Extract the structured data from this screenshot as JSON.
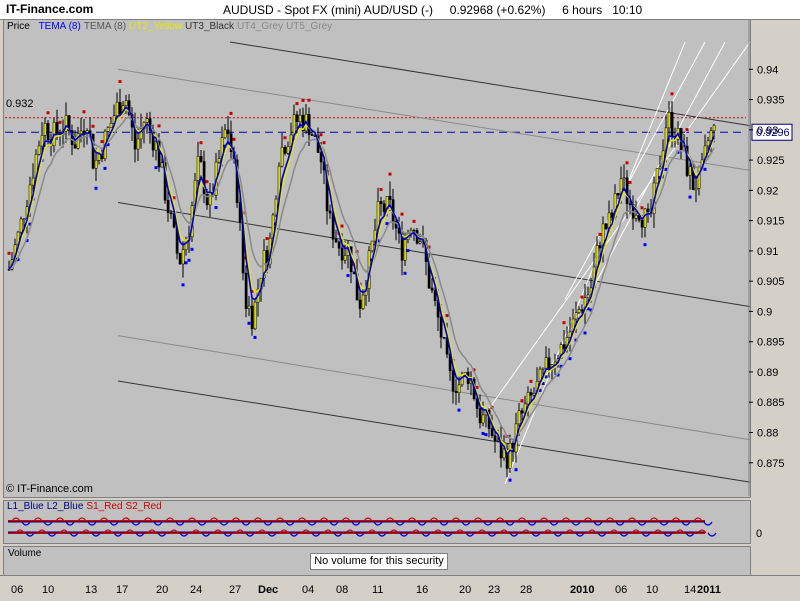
{
  "header": {
    "site": "IT-Finance.com",
    "instrument": "AUDUSD - Spot FX (mini) AUD/USD (-)",
    "last": "0.92968",
    "change": "(+0.62%)",
    "timeframe": "6 hours",
    "time": "10:10"
  },
  "price_panel": {
    "label": "Price",
    "legend": [
      {
        "text": "TEMA (8)",
        "color": "#0000ff"
      },
      {
        "text": "TEMA (8)",
        "color": "#555555"
      },
      {
        "text": "UT2_Yellow",
        "color": "#e8e800"
      },
      {
        "text": "UT3_Black",
        "color": "#333333"
      },
      {
        "text": "UT4_Grey",
        "color": "#888888"
      },
      {
        "text": "UT5_Grey",
        "color": "#888888"
      }
    ],
    "hline_red_label": "0.932",
    "last_price_box": "0.9296",
    "watermark": "© IT-Finance.com"
  },
  "indicator_panel": {
    "legend": [
      {
        "text": "L1_Blue",
        "color": "#000080"
      },
      {
        "text": "L2_Blue",
        "color": "#000080"
      },
      {
        "text": "S1_Red",
        "color": "#cc0000"
      },
      {
        "text": "S2_Red",
        "color": "#cc0000"
      }
    ],
    "zero_label": "0"
  },
  "volume_panel": {
    "label": "Volume",
    "message": "No volume for this security"
  },
  "x_axis": {
    "ticks": [
      {
        "label": "06",
        "bold": false
      },
      {
        "label": "10",
        "bold": false
      },
      {
        "label": "13",
        "bold": false
      },
      {
        "label": "17",
        "bold": false
      },
      {
        "label": "20",
        "bold": false
      },
      {
        "label": "24",
        "bold": false
      },
      {
        "label": "27",
        "bold": false
      },
      {
        "label": "Dec",
        "bold": true
      },
      {
        "label": "04",
        "bold": false
      },
      {
        "label": "08",
        "bold": false
      },
      {
        "label": "11",
        "bold": false
      },
      {
        "label": "16",
        "bold": false
      },
      {
        "label": "20",
        "bold": false
      },
      {
        "label": "23",
        "bold": false
      },
      {
        "label": "28",
        "bold": false
      },
      {
        "label": "2010",
        "bold": true
      },
      {
        "label": "06",
        "bold": false
      },
      {
        "label": "10",
        "bold": false
      },
      {
        "label": "14",
        "bold": false
      },
      {
        "label": "2011",
        "bold": true
      }
    ]
  },
  "chart_data": {
    "type": "candlestick",
    "title": "AUDUSD - Spot FX (mini) AUD/USD (-)",
    "xlabel": "",
    "ylabel": "",
    "ylim": [
      0.8705,
      0.9455
    ],
    "y_ticks": [
      0.875,
      0.88,
      0.885,
      0.89,
      0.895,
      0.9,
      0.905,
      0.91,
      0.915,
      0.92,
      0.925,
      0.93,
      0.935,
      0.94
    ],
    "grid": false,
    "levels": {
      "red_dotted": 0.932,
      "blue_dashed": 0.9296
    },
    "close_path": [
      [
        0,
        0.907
      ],
      [
        10,
        0.913
      ],
      [
        22,
        0.922
      ],
      [
        34,
        0.931
      ],
      [
        44,
        0.929
      ],
      [
        55,
        0.931
      ],
      [
        66,
        0.928
      ],
      [
        78,
        0.932
      ],
      [
        85,
        0.924
      ],
      [
        95,
        0.928
      ],
      [
        106,
        0.933
      ],
      [
        116,
        0.936
      ],
      [
        126,
        0.927
      ],
      [
        136,
        0.932
      ],
      [
        148,
        0.927
      ],
      [
        158,
        0.918
      ],
      [
        170,
        0.908
      ],
      [
        180,
        0.914
      ],
      [
        190,
        0.925
      ],
      [
        200,
        0.917
      ],
      [
        210,
        0.925
      ],
      [
        218,
        0.931
      ],
      [
        228,
        0.92
      ],
      [
        236,
        0.902
      ],
      [
        244,
        0.899
      ],
      [
        252,
        0.907
      ],
      [
        262,
        0.912
      ],
      [
        270,
        0.926
      ],
      [
        282,
        0.93
      ],
      [
        290,
        0.932
      ],
      [
        300,
        0.931
      ],
      [
        312,
        0.925
      ],
      [
        320,
        0.915
      ],
      [
        330,
        0.911
      ],
      [
        340,
        0.91
      ],
      [
        350,
        0.901
      ],
      [
        360,
        0.908
      ],
      [
        370,
        0.917
      ],
      [
        382,
        0.917
      ],
      [
        392,
        0.91
      ],
      [
        402,
        0.915
      ],
      [
        412,
        0.912
      ],
      [
        420,
        0.905
      ],
      [
        430,
        0.898
      ],
      [
        440,
        0.889
      ],
      [
        450,
        0.888
      ],
      [
        460,
        0.89
      ],
      [
        470,
        0.883
      ],
      [
        480,
        0.881
      ],
      [
        490,
        0.877
      ],
      [
        500,
        0.876
      ],
      [
        510,
        0.882
      ],
      [
        520,
        0.885
      ],
      [
        530,
        0.888
      ],
      [
        542,
        0.892
      ],
      [
        552,
        0.894
      ],
      [
        562,
        0.897
      ],
      [
        572,
        0.901
      ],
      [
        582,
        0.904
      ],
      [
        592,
        0.913
      ],
      [
        602,
        0.915
      ],
      [
        612,
        0.922
      ],
      [
        620,
        0.918
      ],
      [
        630,
        0.917
      ],
      [
        640,
        0.914
      ],
      [
        650,
        0.924
      ],
      [
        658,
        0.932
      ],
      [
        666,
        0.93
      ],
      [
        674,
        0.926
      ],
      [
        684,
        0.921
      ],
      [
        692,
        0.922
      ],
      [
        700,
        0.929
      ],
      [
        705,
        0.9297
      ]
    ]
  }
}
